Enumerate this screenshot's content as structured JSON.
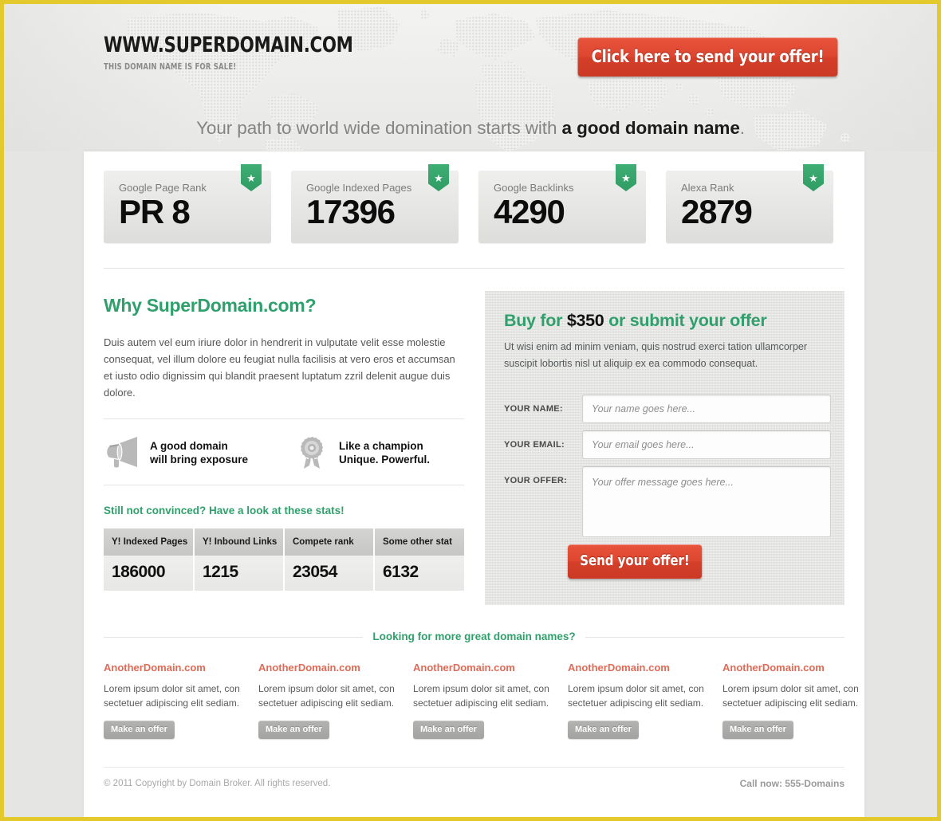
{
  "brand": {
    "title": "WWW.SUPERDOMAIN.COM",
    "subtitle": "THIS DOMAIN NAME IS FOR SALE!"
  },
  "header": {
    "cta_label": "Click here to send your offer!",
    "tagline_normal": "Your path to world wide domination starts with ",
    "tagline_bold": "a good domain name",
    "tagline_end": "."
  },
  "stats": [
    {
      "label": "Google Page Rank",
      "value": "PR 8"
    },
    {
      "label": "Google Indexed Pages",
      "value": "17396"
    },
    {
      "label": "Google Backlinks",
      "value": "4290"
    },
    {
      "label": "Alexa Rank",
      "value": "2879"
    }
  ],
  "why": {
    "heading": "Why SuperDomain.com?",
    "body": "Duis autem vel eum iriure dolor in hendrerit in vulputate velit esse molestie consequat, vel illum dolore eu feugiat nulla facilisis at vero eros et accumsan et iusto odio dignissim qui blandit praesent luptatum zzril delenit augue duis dolore.",
    "features": [
      {
        "icon": "megaphone-icon",
        "line1": "A good domain",
        "line2": "will bring exposure"
      },
      {
        "icon": "award-rosette-icon",
        "line1": "Like a champion",
        "line2": "Unique. Powerful."
      }
    ]
  },
  "ministats": {
    "title": "Still not convinced? Have a look at these stats!",
    "headers": [
      "Y! Indexed Pages",
      "Y! Inbound Links",
      "Compete rank",
      "Some other stat"
    ],
    "values": [
      "186000",
      "1215",
      "23054",
      "6132"
    ]
  },
  "offer": {
    "title_pre": "Buy for ",
    "title_price": "$350",
    "title_post": " or submit your offer",
    "body": "Ut wisi enim ad minim veniam, quis nostrud exerci tation ullamcorper suscipit lobortis nisl ut aliquip ex ea commodo consequat.",
    "fields": [
      {
        "label": "YOUR NAME:",
        "placeholder": "Your name goes here...",
        "value": ""
      },
      {
        "label": "YOUR EMAIL:",
        "placeholder": "Your email goes here...",
        "value": ""
      },
      {
        "label": "YOUR OFFER:",
        "placeholder": "Your offer message goes here...",
        "value": ""
      }
    ],
    "submit_label": "Send your offer!"
  },
  "more": {
    "heading": "Looking for more great domain names?",
    "items": [
      {
        "name": "AnotherDomain.com",
        "desc": "Lorem ipsum dolor sit amet, con sectetuer adipiscing elit sediam.",
        "button": "Make an offer"
      },
      {
        "name": "AnotherDomain.com",
        "desc": "Lorem ipsum dolor sit amet, con sectetuer adipiscing elit sediam.",
        "button": "Make an offer"
      },
      {
        "name": "AnotherDomain.com",
        "desc": "Lorem ipsum dolor sit amet, con sectetuer adipiscing elit sediam.",
        "button": "Make an offer"
      },
      {
        "name": "AnotherDomain.com",
        "desc": "Lorem ipsum dolor sit amet, con sectetuer adipiscing elit sediam.",
        "button": "Make an offer"
      },
      {
        "name": "AnotherDomain.com",
        "desc": "Lorem ipsum dolor sit amet, con sectetuer adipiscing elit sediam.",
        "button": "Make an offer"
      }
    ]
  },
  "footer": {
    "copyright": "© 2011 Copyright by Domain Broker. All rights reserved.",
    "phone": "Call now: 555-Domains"
  },
  "colors": {
    "accent_green": "#2fa06c",
    "accent_red": "#d9452e",
    "domain_link": "#e06a56",
    "page_border": "#e3c92b"
  }
}
